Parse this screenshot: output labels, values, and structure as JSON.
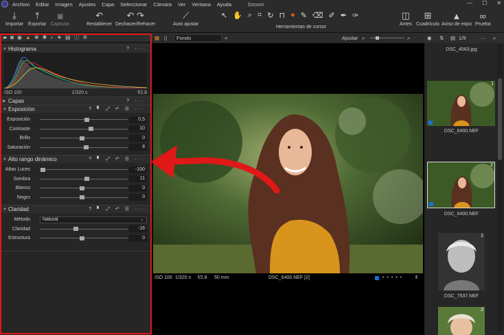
{
  "menu": {
    "items": [
      "Archivo",
      "Editar",
      "Imagen",
      "Ajustes",
      "Capa",
      "Seleccionar",
      "Cámara",
      "Ver",
      "Ventana",
      "Ayuda"
    ],
    "app_title": "Dzoom"
  },
  "toolbar": {
    "importar": "Importar",
    "exportar": "Exportar",
    "capturar": "Capturar",
    "restablecer": "Restablecer",
    "deshacer": "Deshacer/Rehacer",
    "auto_ajustar": "Auto ajustar",
    "cursor_tools_label": "Herramientas de cursor",
    "antes": "Antes",
    "cuadricula": "Cuadrícula",
    "aviso_expo": "Aviso de expo",
    "prueba": "Prueba"
  },
  "left": {
    "histogram": {
      "title": "Histograma",
      "iso": "ISO 100",
      "shutter": "1/320 s",
      "aperture": "f/2.8"
    },
    "capas": {
      "title": "Capas"
    },
    "exposicion": {
      "title": "Exposición",
      "rows": [
        {
          "label": "Exposición",
          "value": "0,5",
          "level": 0.53
        },
        {
          "label": "Contraste",
          "value": "10",
          "level": 0.58
        },
        {
          "label": "Brillo",
          "value": "0",
          "level": 0.48
        },
        {
          "label": "Saturación",
          "value": "8",
          "level": 0.52
        }
      ]
    },
    "hdr": {
      "title": "Alto rango dinámico",
      "rows": [
        {
          "label": "Altas Luces",
          "value": "-100",
          "level": 0.03
        },
        {
          "label": "Sombra",
          "value": "11",
          "level": 0.53
        },
        {
          "label": "Blanco",
          "value": "0",
          "level": 0.48
        },
        {
          "label": "Negro",
          "value": "0",
          "level": 0.48
        }
      ]
    },
    "claridad": {
      "title": "Claridad",
      "metodo_label": "Método",
      "metodo_value": "Natural",
      "rows": [
        {
          "label": "Claridad",
          "value": "-16",
          "level": 0.41
        },
        {
          "label": "Estructura",
          "value": "0",
          "level": 0.48
        }
      ]
    }
  },
  "viewer": {
    "fondo": "Fondo",
    "ajustar": "Ajustar",
    "iso": "ISO 100",
    "shutter": "1/320 s",
    "aperture": "f/2.8",
    "focal": "50 mm",
    "filename": "DSC_6400.NEF [2]"
  },
  "right": {
    "counter": "1/9",
    "top_file": "DSC_4563.jpg",
    "thumbs": [
      {
        "name": "DSC_6400.NEF",
        "badge": "1"
      },
      {
        "name": "DSC_6400.NEF",
        "badge": "2"
      },
      {
        "name": "DSC_7537.NEF",
        "badge": "1"
      },
      {
        "name": "",
        "badge": "2"
      }
    ]
  },
  "colors": {
    "annotation_red": "#e01818",
    "accent_blue": "#1a6fd8",
    "accent_orange": "#e08a2c"
  }
}
